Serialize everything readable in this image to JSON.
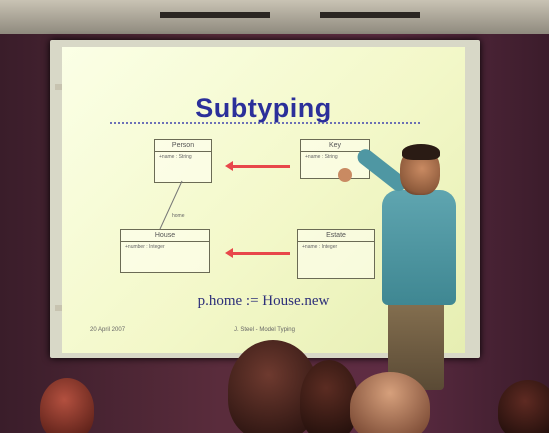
{
  "slide": {
    "title": "Subtyping",
    "boxes": [
      {
        "name": "Person",
        "attr": "+name : String"
      },
      {
        "name": "Key",
        "attr": "+name : String"
      },
      {
        "name": "House",
        "attr": "+number : Integer"
      },
      {
        "name": "Estate",
        "attr": "+name : Integer"
      }
    ],
    "association_label": "home",
    "code": "p.home := House.new",
    "footer_left": "20 April 2007",
    "footer_right": "J. Steel - Model Typing"
  }
}
